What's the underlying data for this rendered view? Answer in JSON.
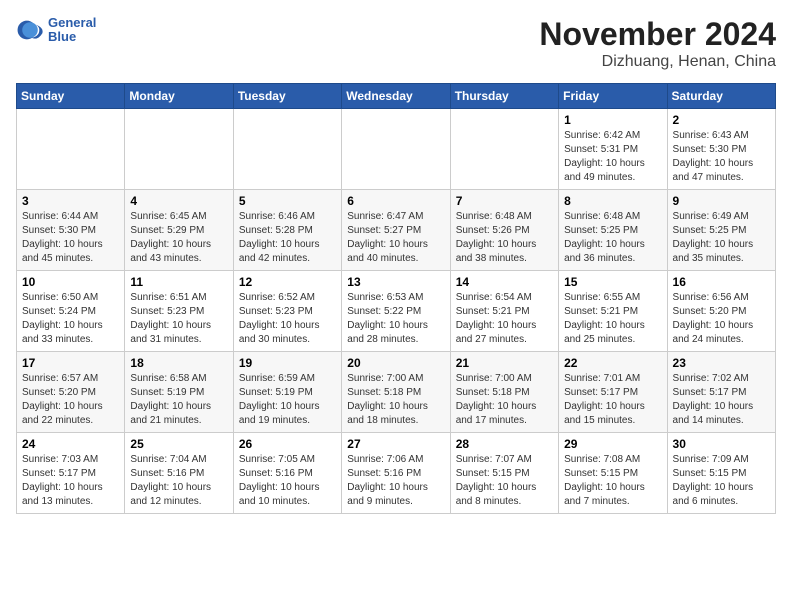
{
  "logo": {
    "line1": "General",
    "line2": "Blue"
  },
  "title": "November 2024",
  "location": "Dizhuang, Henan, China",
  "weekdays": [
    "Sunday",
    "Monday",
    "Tuesday",
    "Wednesday",
    "Thursday",
    "Friday",
    "Saturday"
  ],
  "weeks": [
    [
      {
        "day": "",
        "info": ""
      },
      {
        "day": "",
        "info": ""
      },
      {
        "day": "",
        "info": ""
      },
      {
        "day": "",
        "info": ""
      },
      {
        "day": "",
        "info": ""
      },
      {
        "day": "1",
        "info": "Sunrise: 6:42 AM\nSunset: 5:31 PM\nDaylight: 10 hours\nand 49 minutes."
      },
      {
        "day": "2",
        "info": "Sunrise: 6:43 AM\nSunset: 5:30 PM\nDaylight: 10 hours\nand 47 minutes."
      }
    ],
    [
      {
        "day": "3",
        "info": "Sunrise: 6:44 AM\nSunset: 5:30 PM\nDaylight: 10 hours\nand 45 minutes."
      },
      {
        "day": "4",
        "info": "Sunrise: 6:45 AM\nSunset: 5:29 PM\nDaylight: 10 hours\nand 43 minutes."
      },
      {
        "day": "5",
        "info": "Sunrise: 6:46 AM\nSunset: 5:28 PM\nDaylight: 10 hours\nand 42 minutes."
      },
      {
        "day": "6",
        "info": "Sunrise: 6:47 AM\nSunset: 5:27 PM\nDaylight: 10 hours\nand 40 minutes."
      },
      {
        "day": "7",
        "info": "Sunrise: 6:48 AM\nSunset: 5:26 PM\nDaylight: 10 hours\nand 38 minutes."
      },
      {
        "day": "8",
        "info": "Sunrise: 6:48 AM\nSunset: 5:25 PM\nDaylight: 10 hours\nand 36 minutes."
      },
      {
        "day": "9",
        "info": "Sunrise: 6:49 AM\nSunset: 5:25 PM\nDaylight: 10 hours\nand 35 minutes."
      }
    ],
    [
      {
        "day": "10",
        "info": "Sunrise: 6:50 AM\nSunset: 5:24 PM\nDaylight: 10 hours\nand 33 minutes."
      },
      {
        "day": "11",
        "info": "Sunrise: 6:51 AM\nSunset: 5:23 PM\nDaylight: 10 hours\nand 31 minutes."
      },
      {
        "day": "12",
        "info": "Sunrise: 6:52 AM\nSunset: 5:23 PM\nDaylight: 10 hours\nand 30 minutes."
      },
      {
        "day": "13",
        "info": "Sunrise: 6:53 AM\nSunset: 5:22 PM\nDaylight: 10 hours\nand 28 minutes."
      },
      {
        "day": "14",
        "info": "Sunrise: 6:54 AM\nSunset: 5:21 PM\nDaylight: 10 hours\nand 27 minutes."
      },
      {
        "day": "15",
        "info": "Sunrise: 6:55 AM\nSunset: 5:21 PM\nDaylight: 10 hours\nand 25 minutes."
      },
      {
        "day": "16",
        "info": "Sunrise: 6:56 AM\nSunset: 5:20 PM\nDaylight: 10 hours\nand 24 minutes."
      }
    ],
    [
      {
        "day": "17",
        "info": "Sunrise: 6:57 AM\nSunset: 5:20 PM\nDaylight: 10 hours\nand 22 minutes."
      },
      {
        "day": "18",
        "info": "Sunrise: 6:58 AM\nSunset: 5:19 PM\nDaylight: 10 hours\nand 21 minutes."
      },
      {
        "day": "19",
        "info": "Sunrise: 6:59 AM\nSunset: 5:19 PM\nDaylight: 10 hours\nand 19 minutes."
      },
      {
        "day": "20",
        "info": "Sunrise: 7:00 AM\nSunset: 5:18 PM\nDaylight: 10 hours\nand 18 minutes."
      },
      {
        "day": "21",
        "info": "Sunrise: 7:00 AM\nSunset: 5:18 PM\nDaylight: 10 hours\nand 17 minutes."
      },
      {
        "day": "22",
        "info": "Sunrise: 7:01 AM\nSunset: 5:17 PM\nDaylight: 10 hours\nand 15 minutes."
      },
      {
        "day": "23",
        "info": "Sunrise: 7:02 AM\nSunset: 5:17 PM\nDaylight: 10 hours\nand 14 minutes."
      }
    ],
    [
      {
        "day": "24",
        "info": "Sunrise: 7:03 AM\nSunset: 5:17 PM\nDaylight: 10 hours\nand 13 minutes."
      },
      {
        "day": "25",
        "info": "Sunrise: 7:04 AM\nSunset: 5:16 PM\nDaylight: 10 hours\nand 12 minutes."
      },
      {
        "day": "26",
        "info": "Sunrise: 7:05 AM\nSunset: 5:16 PM\nDaylight: 10 hours\nand 10 minutes."
      },
      {
        "day": "27",
        "info": "Sunrise: 7:06 AM\nSunset: 5:16 PM\nDaylight: 10 hours\nand 9 minutes."
      },
      {
        "day": "28",
        "info": "Sunrise: 7:07 AM\nSunset: 5:15 PM\nDaylight: 10 hours\nand 8 minutes."
      },
      {
        "day": "29",
        "info": "Sunrise: 7:08 AM\nSunset: 5:15 PM\nDaylight: 10 hours\nand 7 minutes."
      },
      {
        "day": "30",
        "info": "Sunrise: 7:09 AM\nSunset: 5:15 PM\nDaylight: 10 hours\nand 6 minutes."
      }
    ]
  ]
}
